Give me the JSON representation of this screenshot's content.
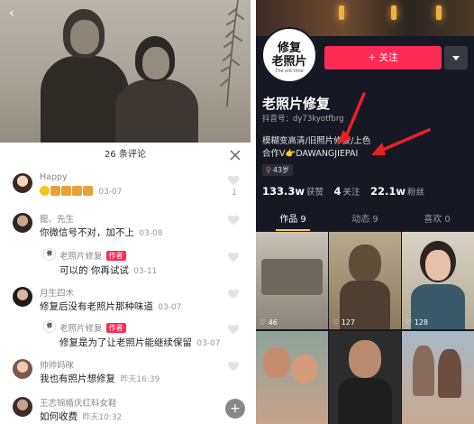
{
  "left": {
    "comments_count_label": "26 条评论",
    "comments": [
      {
        "name": "Happy",
        "text": "03-07",
        "likes": "1"
      },
      {
        "name": "寵、先生",
        "text": "你微信号不对，加不上",
        "time": "03-08"
      },
      {
        "name": "老照片修复",
        "badge": "作者",
        "text": "可以的 你再试试",
        "time": "03-11"
      },
      {
        "name": "月生四木",
        "text": "修复后没有老照片那种味道",
        "time": "03-07"
      },
      {
        "name": "老照片修复",
        "badge": "作者",
        "text": "修复是为了让老照片能继续保留",
        "time": "03-07"
      },
      {
        "name": "帅帅妈咪",
        "text": "我也有照片想修复",
        "time": "昨天16:39"
      },
      {
        "name": "王志锦婚庆红科女鞋",
        "text": "如何收费",
        "time": "昨天10:32"
      }
    ]
  },
  "right": {
    "logo_line1": "修复",
    "logo_line2": "老照片",
    "logo_line3": "The old time",
    "follow_label": "+ 关注",
    "profile_name": "老照片修复",
    "douyin_id": "抖音号：dy73kyotfbrg",
    "bio_line1": "模糊变高清/旧照片修复/上色",
    "bio_line2": "合作V👉DAWANGJIEPAI",
    "tag_age": "43岁",
    "stats": {
      "likes_num": "133.3w",
      "likes_label": "获赞",
      "following_num": "4",
      "following_label": "关注",
      "fans_num": "22.1w",
      "fans_label": "粉丝"
    },
    "tabs": [
      "作品 9",
      "动态 9",
      "喜欢 0"
    ],
    "grid_likes": [
      "46",
      "127",
      "128"
    ]
  },
  "colors": {
    "accent": "#fe2c55",
    "dark_bg": "#161823",
    "tab_underline": "#facc2e"
  }
}
